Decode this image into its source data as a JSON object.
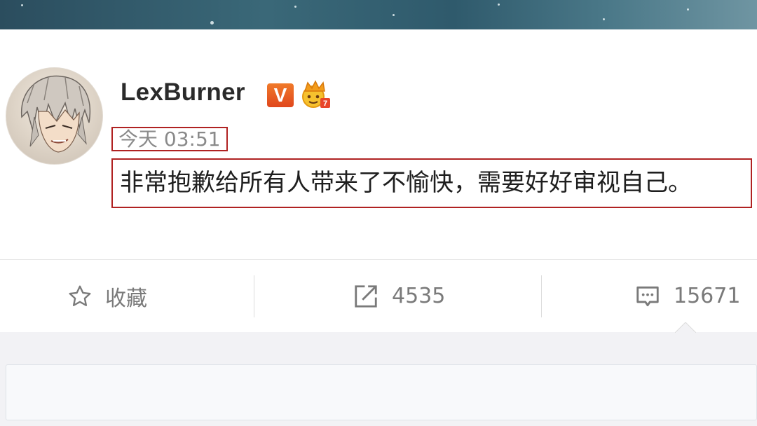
{
  "post": {
    "username": "LexBurner",
    "verified_badge": "V",
    "timestamp": "今天 03:51",
    "content": "非常抱歉给所有人带来了不愉快，需要好好审视自己。"
  },
  "actions": {
    "favorite_label": "收藏",
    "repost_count": "4535",
    "comment_count": "15671"
  },
  "icons": [
    "star-icon",
    "share-icon",
    "comment-icon",
    "crown-icon",
    "verified-icon"
  ],
  "colors": {
    "highlight_border": "#b02222",
    "badge_orange": "#e0461c",
    "muted_text": "#7a7a7a"
  }
}
